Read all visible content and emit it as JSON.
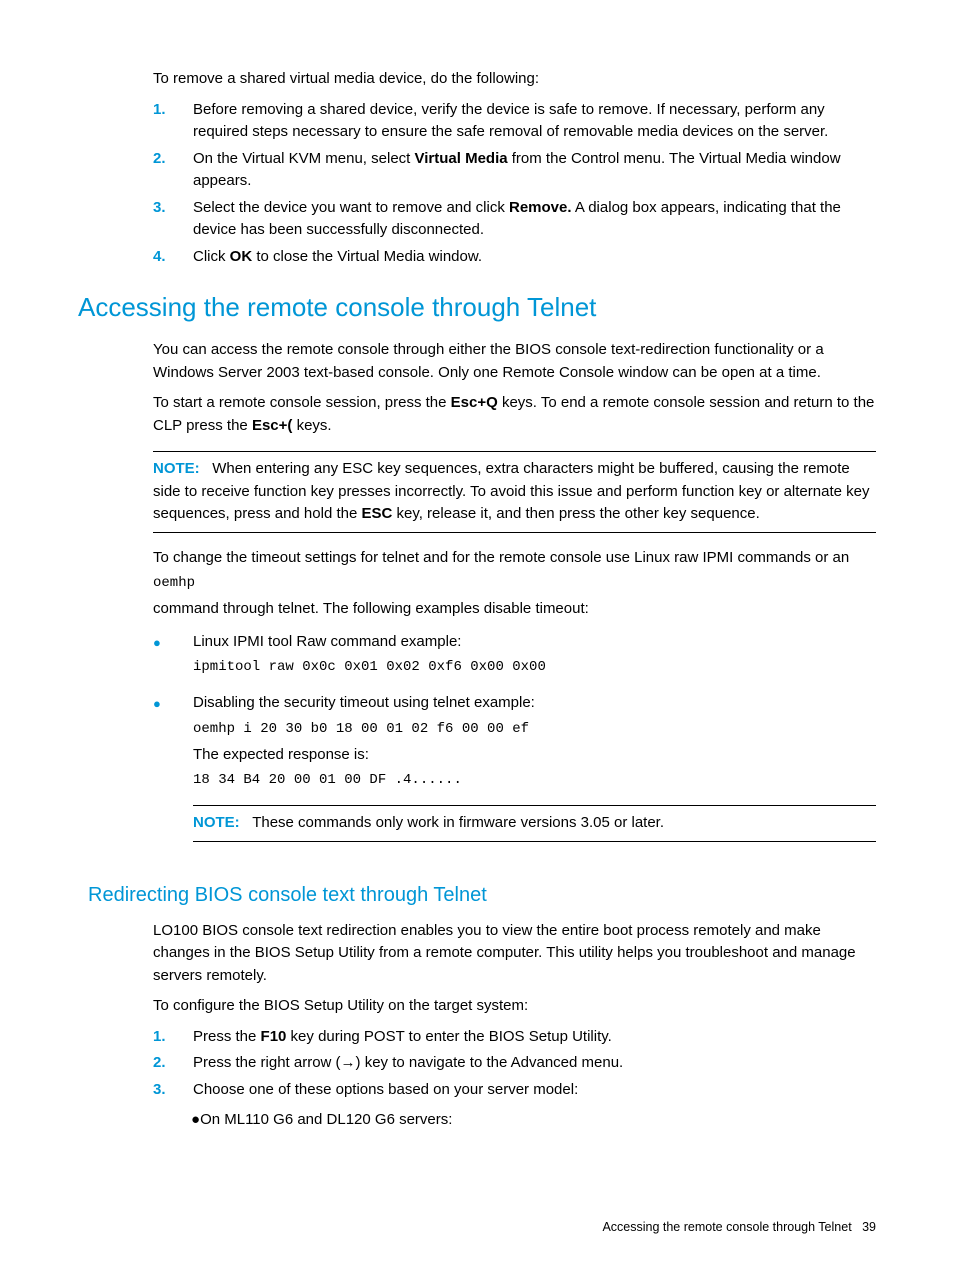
{
  "intro": {
    "p1": "To remove a shared virtual media device, do the following:",
    "steps": [
      {
        "num": "1.",
        "text": "Before removing a shared device, verify the device is safe to remove. If necessary, perform any required steps necessary to ensure the safe removal of removable media devices on the server."
      },
      {
        "num": "2.",
        "text_a": "On the Virtual KVM menu, select ",
        "bold": "Virtual Media",
        "text_b": " from the Control menu. The Virtual Media window appears."
      },
      {
        "num": "3.",
        "text_a": "Select the device you want to remove and click ",
        "bold": "Remove.",
        "text_b": " A dialog box appears, indicating that the device has been successfully disconnected."
      },
      {
        "num": "4.",
        "text_a": "Click ",
        "bold": "OK",
        "text_b": " to close the Virtual Media window."
      }
    ]
  },
  "section1": {
    "heading": "Accessing the remote console through Telnet",
    "p1": "You can access the remote console through either the BIOS console text-redirection functionality or a Windows Server 2003 text-based console. Only one Remote Console window can be open at a time.",
    "p2_a": "To start a remote console session, press the ",
    "p2_bold1": "Esc+Q",
    "p2_b": " keys. To end a remote console session and return to the CLP press the ",
    "p2_bold2": "Esc+(",
    "p2_c": " keys.",
    "note1_label": "NOTE:",
    "note1_a": "When entering any ESC key sequences, extra characters might be buffered, causing the remote side to receive function key presses incorrectly. To avoid this issue and perform function key or alternate key sequences, press and hold the ",
    "note1_bold": "ESC",
    "note1_b": " key, release it, and then press the other key sequence.",
    "p3": "To change the timeout settings for telnet and for the remote console use Linux raw IPMI commands or an",
    "p3_code": "oemhp",
    "p4": "command through telnet. The following examples disable timeout:",
    "bullets": [
      {
        "label": "Linux IPMI tool Raw command example:",
        "code": "ipmitool raw 0x0c 0x01 0x02 0xf6 0x00 0x00"
      },
      {
        "label": "Disabling the security timeout using telnet example:",
        "code1": "oemhp i 20 30 b0 18 00 01 02 f6 00 00 ef",
        "resp_label": "The expected response is:",
        "code2": "18 34 B4 20 00 01 00 DF  .4......",
        "note_label": "NOTE:",
        "note_text": "These commands only work in firmware versions 3.05 or later."
      }
    ]
  },
  "section2": {
    "heading": "Redirecting BIOS console text through Telnet",
    "p1": "LO100 BIOS console text redirection enables you to view the entire boot process remotely and make changes in the BIOS Setup Utility from a remote computer. This utility helps you troubleshoot and manage servers remotely.",
    "p2": "To configure the BIOS Setup Utility on the target system:",
    "steps": [
      {
        "num": "1.",
        "text_a": "Press the ",
        "bold": "F10",
        "text_b": " key during POST to enter the BIOS Setup Utility."
      },
      {
        "num": "2.",
        "text": "Press the right arrow (→) key to navigate to the Advanced menu."
      },
      {
        "num": "3.",
        "text": "Choose one of these options based on your server model:"
      }
    ],
    "sub_bullet": "On ML110 G6 and DL120 G6 servers:"
  },
  "footer": {
    "text": "Accessing the remote console through Telnet",
    "page": "39"
  }
}
